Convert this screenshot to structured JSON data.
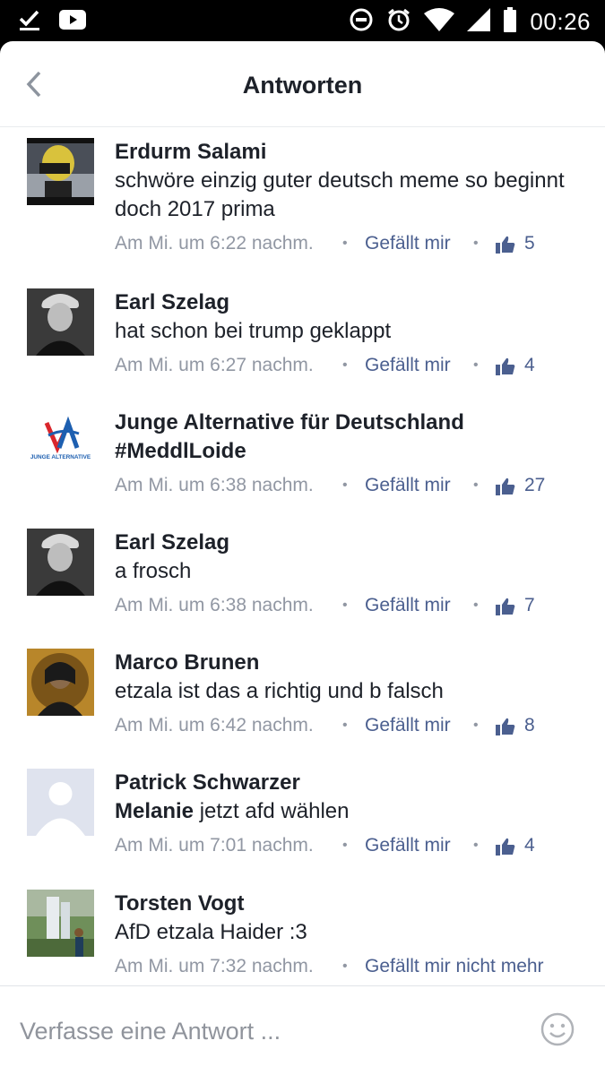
{
  "status_bar": {
    "time": "00:26",
    "icons": [
      "download-done-icon",
      "youtube-icon",
      "do-not-disturb-icon",
      "alarm-icon",
      "wifi-icon",
      "signal-icon",
      "battery-icon"
    ]
  },
  "header": {
    "title": "Antworten",
    "back_icon": "chevron-left-icon"
  },
  "comments": [
    {
      "name": "Erdurm Salami",
      "text": "schwöre einzig guter deutsch meme so beginnt doch 2017 prima",
      "time": "Am Mi. um 6:22 nachm.",
      "like_label": "Gefällt mir",
      "likes": "5"
    },
    {
      "name": "Earl Szelag",
      "text": "hat schon bei trump geklappt",
      "time": "Am Mi. um 6:27 nachm.",
      "like_label": "Gefällt mir",
      "likes": "4"
    },
    {
      "name": "Junge Alternative für Deutschland",
      "text": "#MeddlLoide",
      "time": "Am Mi. um 6:38 nachm.",
      "like_label": "Gefällt mir",
      "likes": "27",
      "avatar_caption": "JUNGE ALTERNATIVE"
    },
    {
      "name": "Earl Szelag",
      "text": "a frosch",
      "time": "Am Mi. um 6:38 nachm.",
      "like_label": "Gefällt mir",
      "likes": "7"
    },
    {
      "name": "Marco Brunen",
      "text": "etzala ist das a richtig und b falsch",
      "time": "Am Mi. um 6:42 nachm.",
      "like_label": "Gefällt mir",
      "likes": "8"
    },
    {
      "name": "Patrick Schwarzer",
      "mention": "Melanie",
      "text": " jetzt afd wählen",
      "time": "Am Mi. um 7:01 nachm.",
      "like_label": "Gefällt mir",
      "likes": "4"
    },
    {
      "name": "Torsten Vogt",
      "text": "AfD etzala Haider :3",
      "time": "Am Mi. um 7:32 nachm.",
      "like_label": "Gefällt mir nicht mehr"
    }
  ],
  "compose": {
    "placeholder": "Verfasse eine Antwort ...",
    "emoji_icon": "smiley-icon"
  },
  "colors": {
    "text": "#1d2129",
    "meta": "#9197a3",
    "link": "#4b5f8f",
    "divider": "#e9ebee"
  }
}
